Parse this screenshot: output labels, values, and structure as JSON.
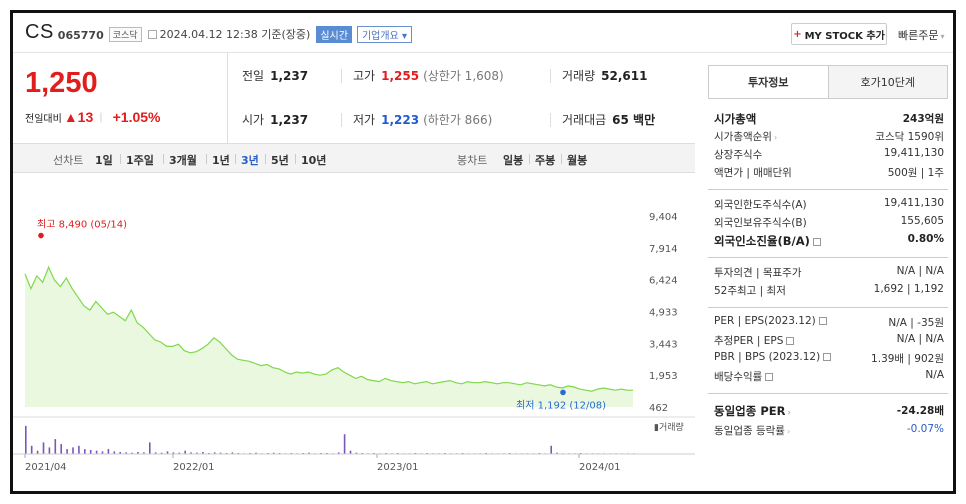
{
  "header": {
    "company": "CS",
    "code": "065770",
    "market": "코스닥",
    "datetime": "2024.04.12 12:38 기준(장중)",
    "realtime": "실시간",
    "company_info": "기업개요",
    "my_stock": "MY STOCK 추가",
    "quick_order": "빠른주문"
  },
  "price": {
    "current": "1,250",
    "change_label": "전일대비",
    "change": "▲13",
    "change_pct": "+1.05%"
  },
  "stats": {
    "prev_label": "전일",
    "prev": "1,237",
    "high_label": "고가",
    "high": "1,255",
    "upper_limit": "(상한가 1,608)",
    "volume_label": "거래량",
    "volume": "52,611",
    "open_label": "시가",
    "open": "1,237",
    "low_label": "저가",
    "low": "1,223",
    "lower_limit": "(하한가 866)",
    "amount_label": "거래대금",
    "amount": "65 백만"
  },
  "period": {
    "line_label": "선차트",
    "items": [
      "1일",
      "1주일",
      "3개월",
      "1년",
      "3년",
      "5년",
      "10년"
    ],
    "active": "3년",
    "candle_label": "봉차트",
    "candles": [
      "일봉",
      "주봉",
      "월봉"
    ]
  },
  "chart_data": {
    "type": "area",
    "y_ticks": [
      "9,404",
      "7,914",
      "6,424",
      "4,933",
      "3,443",
      "1,953",
      "462"
    ],
    "ylim": [
      462,
      9404
    ],
    "x_ticks": [
      "2021/04",
      "2022/01",
      "2023/01",
      "2024/01"
    ],
    "high_label": "최고 8,490 (05/14)",
    "low_label": "최저 1,192 (12/08)",
    "volume_label": "거래량",
    "series": [
      {
        "values": [
          6700,
          6000,
          6600,
          6300,
          7000,
          6400,
          6100,
          6500,
          6000,
          5600,
          5200,
          5000,
          5400,
          5100,
          4800,
          4900,
          4700,
          4500,
          5000,
          4400,
          4200,
          3900,
          3600,
          3500,
          3300,
          3300,
          3400,
          3100,
          3000,
          3050,
          3200,
          3400,
          3700,
          3500,
          3200,
          2900,
          2700,
          2650,
          2600,
          2500,
          2400,
          2450,
          2300,
          2250,
          2100,
          2000,
          2100,
          2050,
          2100,
          2000,
          1950,
          2000,
          2200,
          2300,
          2100,
          1950,
          1800,
          1900,
          1750,
          1700,
          1650,
          1800,
          1700,
          1650,
          1600,
          1650,
          1550,
          1600,
          1650,
          1550,
          1600,
          1650,
          1700,
          1600,
          1550,
          1650,
          1600,
          1600,
          1650,
          1600,
          1550,
          1600,
          1600,
          1550,
          1500,
          1600,
          1550,
          1500,
          1450,
          1500,
          1400,
          1350,
          1450,
          1400,
          1300,
          1250,
          1200,
          1300,
          1350,
          1300,
          1250,
          1300,
          1250,
          1250
        ]
      }
    ],
    "volume": [
      0.85,
      0.25,
      0.1,
      0.35,
      0.2,
      0.45,
      0.3,
      0.15,
      0.2,
      0.25,
      0.15,
      0.12,
      0.1,
      0.08,
      0.15,
      0.08,
      0.06,
      0.05,
      0.04,
      0.06,
      0.05,
      0.35,
      0.05,
      0.04,
      0.08,
      0.05,
      0.04,
      0.1,
      0.05,
      0.04,
      0.06,
      0.03,
      0.05,
      0.04,
      0.03,
      0.05,
      0.03,
      0.02,
      0.03,
      0.04,
      0.02,
      0.03,
      0.04,
      0.03,
      0.02,
      0.03,
      0.02,
      0.03,
      0.04,
      0.02,
      0.03,
      0.03,
      0.02,
      0.05,
      0.6,
      0.1,
      0.04,
      0.03,
      0.02,
      0.03,
      0.02,
      0.03,
      0.02,
      0.03,
      0.02,
      0.02,
      0.03,
      0.02,
      0.03,
      0.02,
      0.02,
      0.03,
      0.02,
      0.02,
      0.03,
      0.02,
      0.02,
      0.02,
      0.03,
      0.02,
      0.02,
      0.02,
      0.03,
      0.02,
      0.02,
      0.02,
      0.02,
      0.03,
      0.02,
      0.25,
      0.04,
      0.02,
      0.02,
      0.02,
      0.03,
      0.02,
      0.02,
      0.02,
      0.02,
      0.02,
      0.02,
      0.02,
      0.02,
      0.02
    ]
  },
  "right_panel": {
    "tabs": [
      "투자정보",
      "호가10단계"
    ],
    "rows": [
      {
        "k": "시가총액",
        "v": "243억원"
      },
      {
        "k": "시가총액순위",
        "v": "코스닥 1590위"
      },
      {
        "k": "상장주식수",
        "v": "19,411,130"
      },
      {
        "k": "액면가 | 매매단위",
        "v": "500원 | 1주"
      },
      {
        "k": "외국인한도주식수(A)",
        "v": "19,411,130"
      },
      {
        "k": "외국인보유주식수(B)",
        "v": "155,605"
      },
      {
        "k": "외국인소진율(B/A)",
        "v": "0.80%"
      },
      {
        "k": "투자의견 | 목표주가",
        "v": "N/A | N/A"
      },
      {
        "k": "52주최고 | 최저",
        "v": "1,692 | 1,192"
      },
      {
        "k": "PER | EPS(2023.12)",
        "v": "N/A | -35원"
      },
      {
        "k": "추정PER | EPS",
        "v": "N/A | N/A"
      },
      {
        "k": "PBR | BPS (2023.12)",
        "v": "1.39배 | 902원"
      },
      {
        "k": "배당수익률",
        "v": "N/A"
      },
      {
        "k": "동일업종 PER",
        "v": "-24.28배"
      },
      {
        "k": "동일업종 등락률",
        "v": "-0.07%"
      }
    ]
  },
  "colors": {
    "up": "#e01e1e",
    "down": "#1f5bd0",
    "line": "#7fd84a",
    "area": "#e9f8de"
  }
}
